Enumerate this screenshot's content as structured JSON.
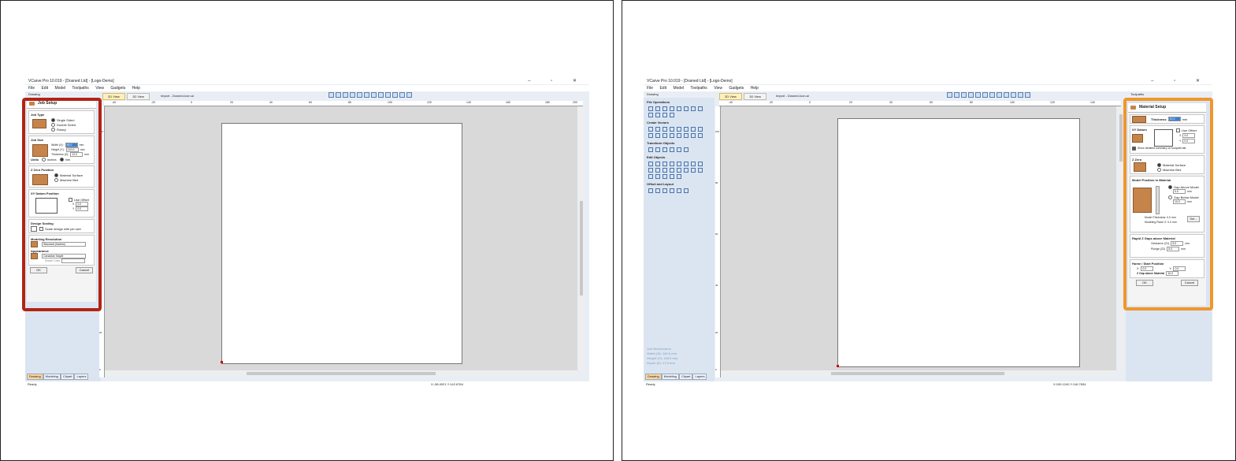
{
  "left": {
    "window_title": "VCarve Pro 10.019 - [Dosned Ltd] - [Logo-Demo]",
    "menus": [
      "File",
      "Edit",
      "Model",
      "Toolpaths",
      "View",
      "Gadgets",
      "Help"
    ],
    "panel_title": "Drawing",
    "tabs": [
      "2D View",
      "3D View"
    ],
    "import_label": "Import - Dosned-Icon.ai",
    "ruler_labels": [
      "-40",
      "-20",
      "0",
      "20",
      "40",
      "60",
      "80",
      "100",
      "120",
      "140",
      "160",
      "180",
      "200"
    ],
    "vruler_labels": [
      "100",
      "80",
      "60",
      "40",
      "20",
      "0"
    ],
    "bottom_tabs": [
      "Drawing",
      "Modeling",
      "Clipart",
      "Layers"
    ],
    "status_left": "Ready",
    "status_right": "X:-58.4921 Y:142.6784",
    "dialog": {
      "title": "Job Setup",
      "job_type_title": "Job Type",
      "job_type_options": [
        "Single Sided",
        "Double Sided",
        "Rotary"
      ],
      "job_size_title": "Job Size",
      "width_label": "Width (X):",
      "width_value": "66.0",
      "height_label": "Height (Y):",
      "height_value": "140.0",
      "thickness_label": "Thickness (Z):",
      "thickness_value": "12.0",
      "unit": "mm",
      "units_label": "Units",
      "units_options": [
        "inches",
        "mm"
      ],
      "zzero_title": "Z Zero Position",
      "zzero_options": [
        "Material Surface",
        "Machine Bed"
      ],
      "xy_title": "XY Datum Position",
      "use_offset": "Use Offset",
      "x_label": "X",
      "y_label": "Y",
      "x_value": "0.0",
      "y_value": "0.0",
      "design_scaling_title": "Design Scaling",
      "scale_label": "Scale design with job size",
      "modeling_res_title": "Modeling Resolution",
      "modeling_res_value": "Standard (fastest)",
      "appearance_title": "Appearance",
      "appearance_value": "Canadian Maple",
      "shade_label": "Shade Color",
      "ok": "OK",
      "cancel": "Cancel"
    }
  },
  "right": {
    "window_title": "VCarve Pro 10.019 - [Dosned Ltd] - [Logo-Demo]",
    "menus": [
      "File",
      "Edit",
      "Model",
      "Toolpaths",
      "View",
      "Gadgets",
      "Help"
    ],
    "panel_title": "Drawing",
    "right_panel_title": "Toolpaths",
    "tabs": [
      "2D View",
      "3D View"
    ],
    "import_label": "Import - Dosned-Icon.ai",
    "ruler_labels": [
      "-40",
      "-20",
      "0",
      "20",
      "40",
      "60",
      "80",
      "100",
      "120",
      "140"
    ],
    "vruler_labels": [
      "100",
      "80",
      "60",
      "40",
      "20",
      "0"
    ],
    "tool_groups": [
      "File Operations",
      "Create Vectors",
      "Transform Objects",
      "Edit Objects",
      "Offset and Layout"
    ],
    "job_dims": {
      "title": "Job Dimensions",
      "width": "Width (X): 140.0 mm",
      "height": "Height (Y): 140.0 mm",
      "depth": "Depth (Z): 17.5 mm"
    },
    "bottom_tabs": [
      "Drawing",
      "Modeling",
      "Clipart",
      "Layers"
    ],
    "status_left": "Ready",
    "status_right": "X:159.1240 Y:116.7834",
    "dialog": {
      "title": "Material Setup",
      "thickness_label": "Thickness",
      "thickness_value": "10.0",
      "unit": "mm",
      "xy_title": "XY Datum",
      "use_offset": "Use Offset",
      "x_label": "X",
      "y_label": "Y",
      "x_value": "0.0",
      "y_value": "0.0",
      "summary_label": "Show detailed summary on toolpath tab",
      "zzero_title": "Z Zero",
      "zzero_options": [
        "Material Surface",
        "Machine Bed"
      ],
      "model_pos_title": "Model Position in Material",
      "gap_above": "Gap Above Model",
      "gap_above_value": "0.0",
      "gap_below": "Gap Below Model",
      "gap_below_value": "10.0",
      "model_thickness": "Model Thickness: 0.0 mm",
      "modeling_plane": "Modeling Plane Z: 0.0 mm",
      "set_button": "Set...",
      "rapid_title": "Rapid Z Gaps above Material",
      "clearance_label": "Clearance (Z1)",
      "clearance_value": "5.0",
      "plunge_label": "Plunge (Z2)",
      "plunge_value": "5.0",
      "home_title": "Home / Start Position",
      "home_x_label": "X:",
      "home_x_value": "0.0",
      "home_y_label": "Y:",
      "home_y_value": "0.0",
      "zgap_label": "Z Gap above Material",
      "zgap_value": "10.0",
      "ok": "OK",
      "cancel": "Cancel"
    }
  },
  "colors": {
    "left_highlight": "#b32313",
    "right_highlight": "#f0962d",
    "panel_bg": "#dbe5f1",
    "canvas_bg": "#d9d9d9"
  }
}
